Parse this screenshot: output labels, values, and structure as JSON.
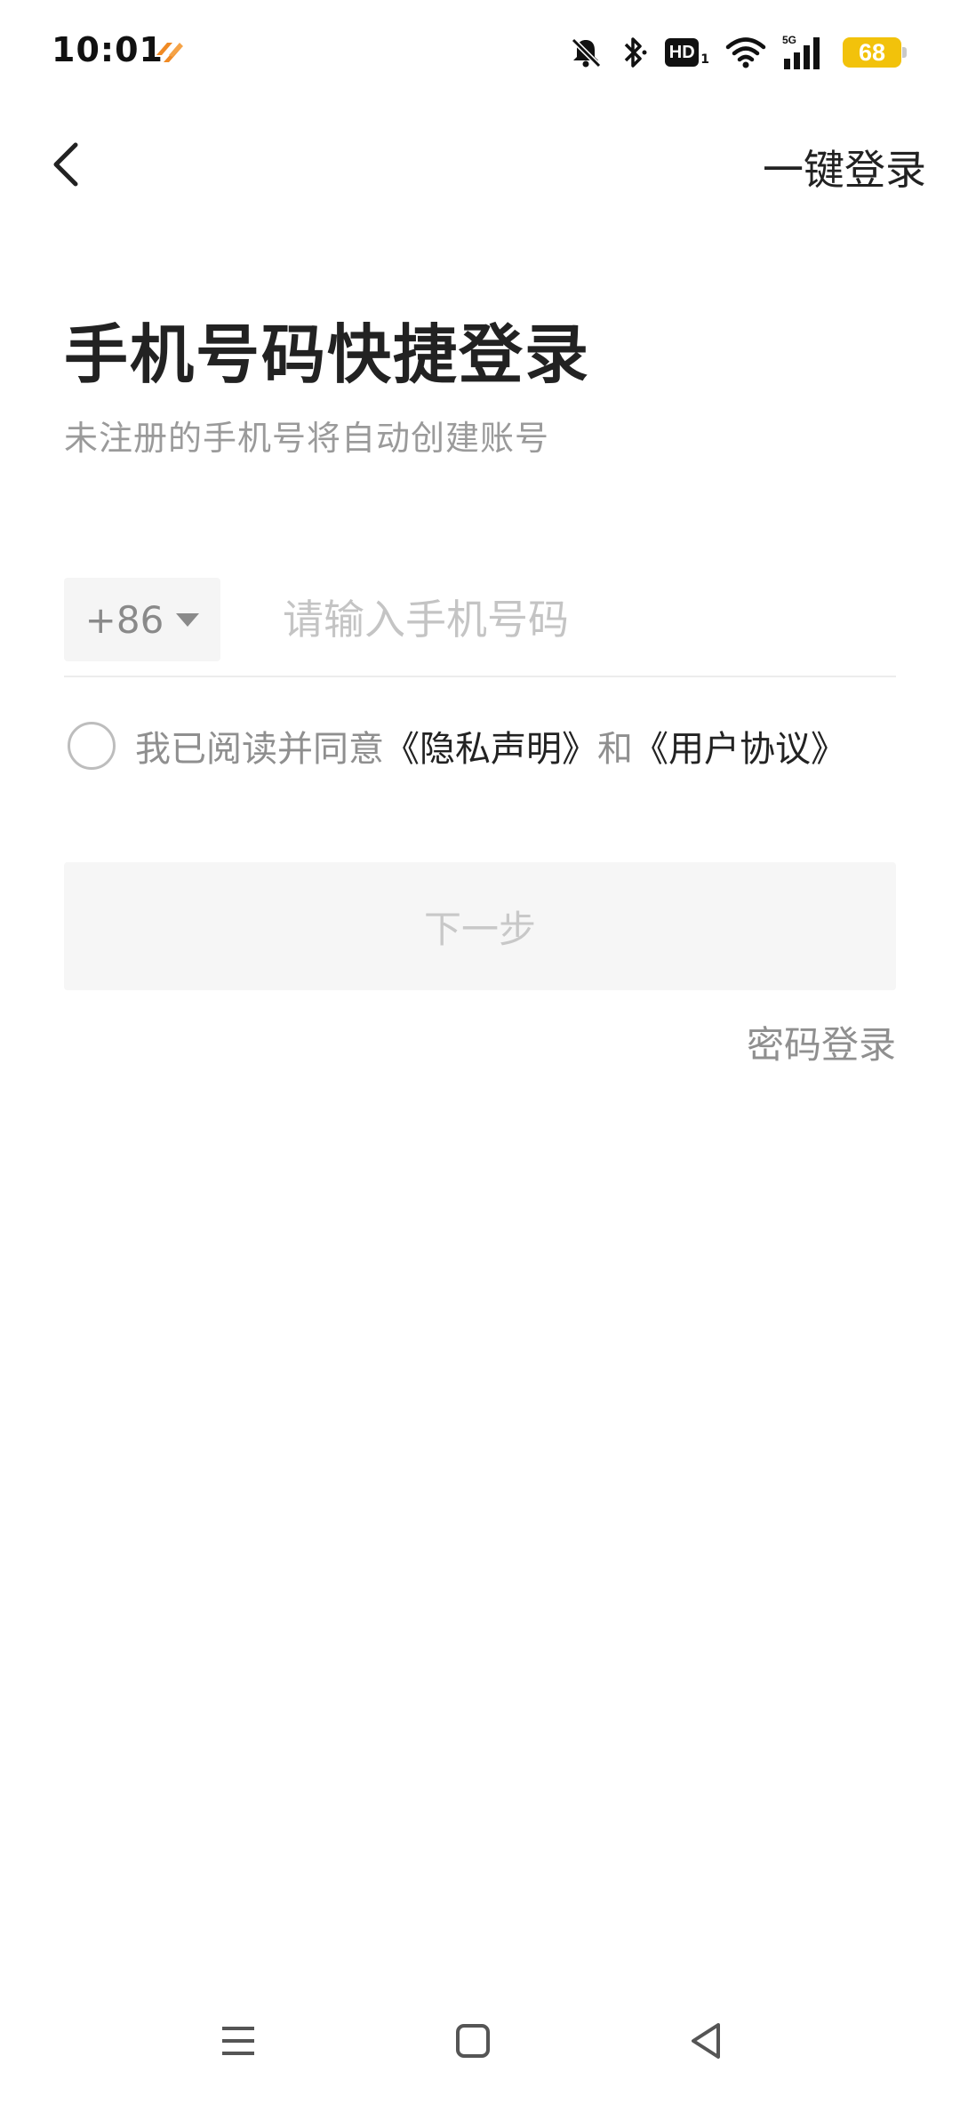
{
  "status_bar": {
    "time": "10:01",
    "hd_label": "HD",
    "hd_sub": "1",
    "network": "5G",
    "battery": "68",
    "colors": {
      "battery": "#f2c20b",
      "app_icon": "#f08a24"
    },
    "icons": [
      "app-badge-icon",
      "bell-muted-icon",
      "bluetooth-icon",
      "hd-icon",
      "wifi-icon",
      "signal-icon",
      "battery-icon"
    ]
  },
  "nav": {
    "back_icon": "chevron-left-icon",
    "one_click_login": "一键登录"
  },
  "header": {
    "title": "手机号码快捷登录",
    "subtitle": "未注册的手机号将自动创建账号"
  },
  "phone": {
    "country_code": "+86",
    "placeholder": "请输入手机号码",
    "value": ""
  },
  "agreement": {
    "checked": false,
    "prefix": "我已阅读并同意",
    "privacy_link": "《隐私声明》",
    "and": "和",
    "terms_link": "《用户协议》"
  },
  "actions": {
    "next": "下一步",
    "password_login": "密码登录"
  },
  "system_nav": {
    "icons": [
      "menu-icon",
      "home-icon",
      "back-triangle-icon"
    ]
  }
}
